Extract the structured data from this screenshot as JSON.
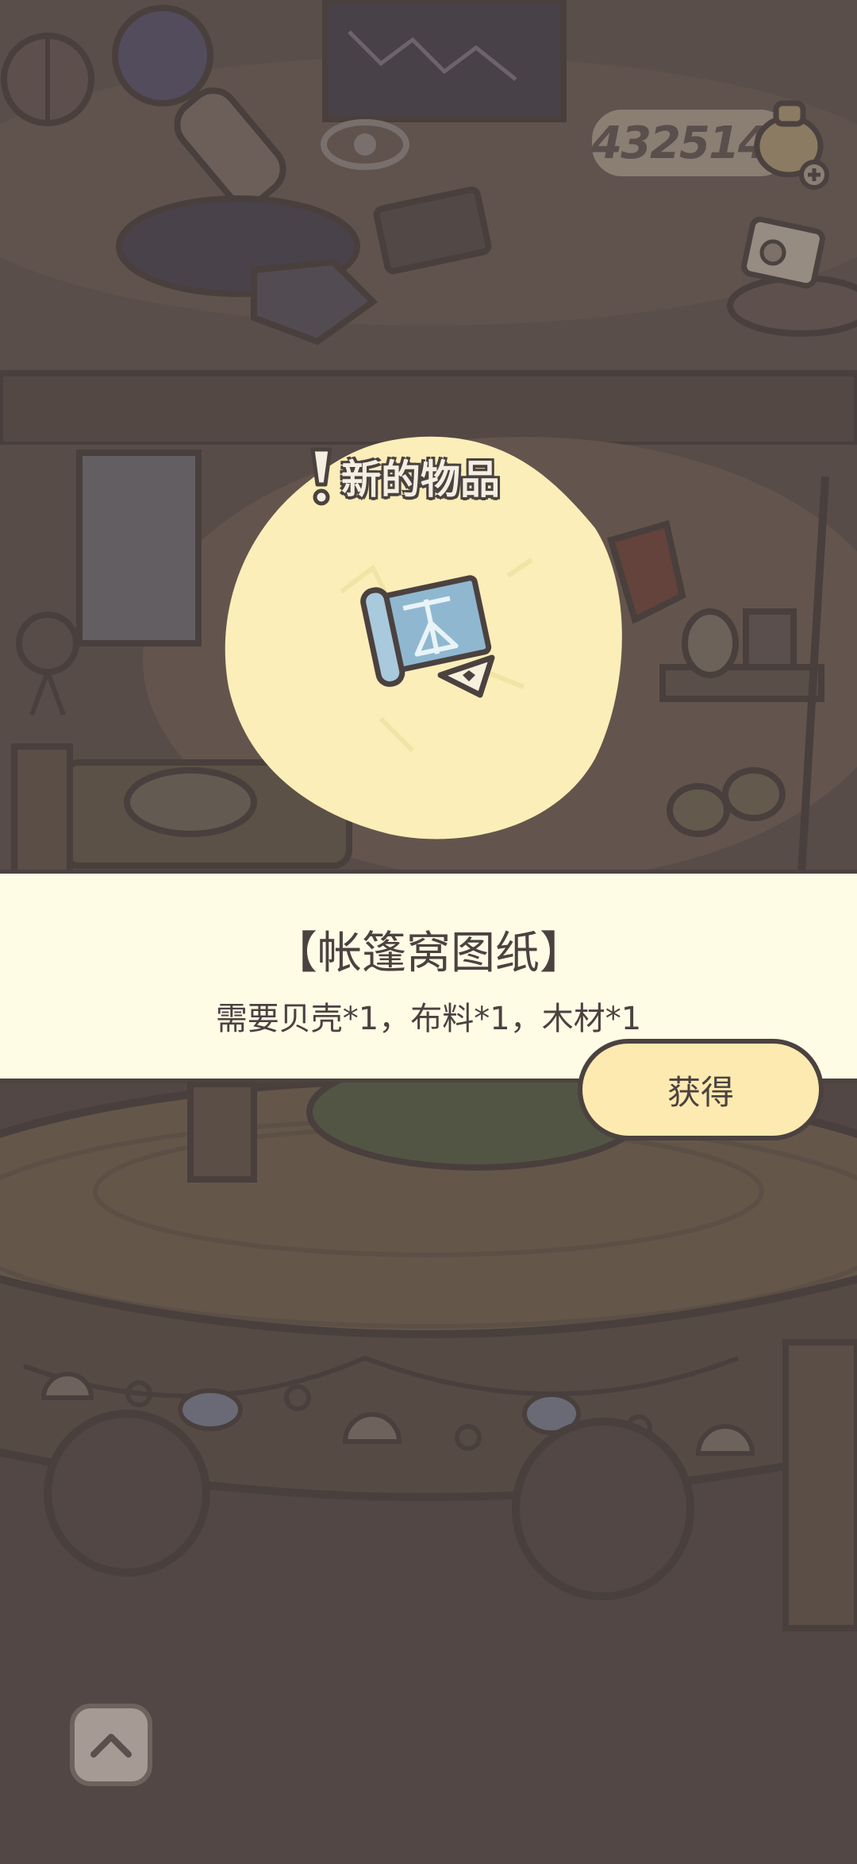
{
  "hud": {
    "coin_count": "432514",
    "coin_bag_icon": "coin-bag-plus-icon",
    "coupon_icon": "ticket-icon"
  },
  "popup": {
    "title": "新的物品",
    "alert_icon": "exclamation-icon",
    "item_icon": "blueprint-scroll-icon",
    "item_name": "【帐篷窝图纸】",
    "requirements": "需要贝壳*1，布料*1，木材*1",
    "obtain_label": "获得"
  },
  "nav": {
    "scroll_up_icon": "chevron-up-icon"
  },
  "colors": {
    "band_bg": "#fffce6",
    "button_bg": "#fdeab0",
    "blob": "#fbeeb8",
    "outline": "#4b4240"
  }
}
